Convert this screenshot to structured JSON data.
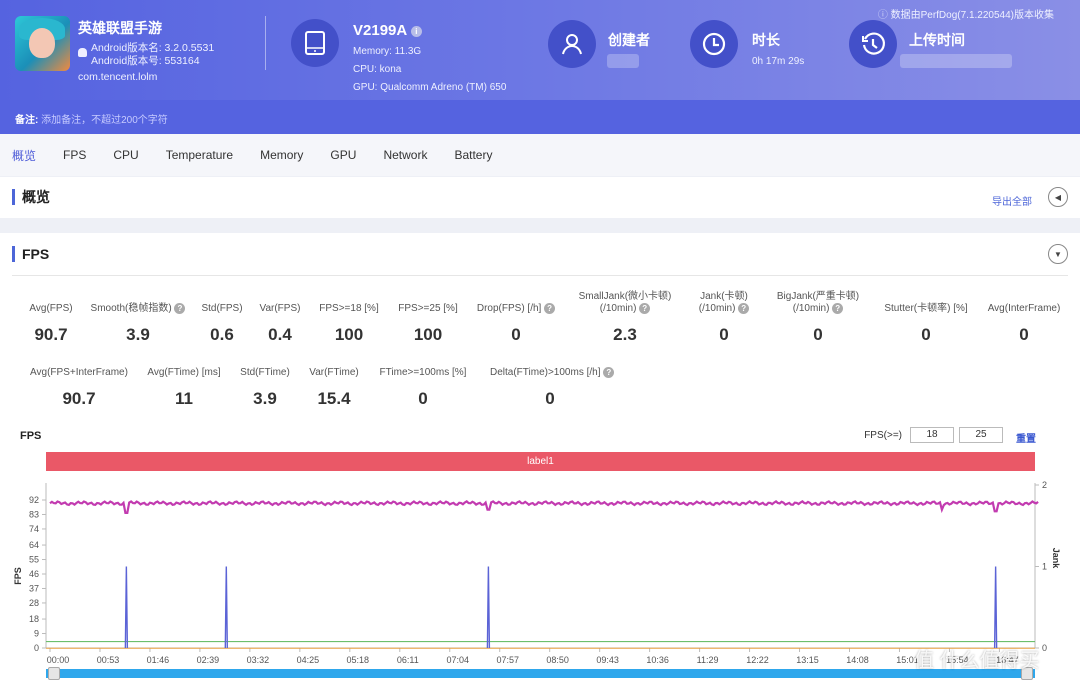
{
  "app": {
    "title": "英雄联盟手游",
    "version_name": "Android版本名: 3.2.0.5531",
    "version_code": "Android版本号: 553164",
    "package": "com.tencent.lolm"
  },
  "device": {
    "model": "V2199A",
    "memory": "Memory: 11.3G",
    "cpu": "CPU: kona",
    "gpu": "GPU: Qualcomm Adreno (TM) 650"
  },
  "creator": {
    "title": "创建者"
  },
  "duration": {
    "title": "时长",
    "value": "0h 17m 29s"
  },
  "upload": {
    "title": "上传时间"
  },
  "collect_note": "数据由PerfDog(7.1.220544)版本收集",
  "note": {
    "label": "备注:",
    "placeholder": "添加备注，不超过200个字符"
  },
  "tabs": [
    "概览",
    "FPS",
    "CPU",
    "Temperature",
    "Memory",
    "GPU",
    "Network",
    "Battery"
  ],
  "overview": {
    "title": "概览",
    "export_label": "导出全部"
  },
  "fps_section": {
    "title": "FPS",
    "metrics_row1": [
      {
        "label": "Avg(FPS)",
        "value": "90.7"
      },
      {
        "label": "Smooth(稳帧指数)",
        "value": "3.9",
        "help": true
      },
      {
        "label": "Std(FPS)",
        "value": "0.6"
      },
      {
        "label": "Var(FPS)",
        "value": "0.4"
      },
      {
        "label": "FPS>=18 [%]",
        "value": "100"
      },
      {
        "label": "FPS>=25 [%]",
        "value": "100"
      },
      {
        "label": "Drop(FPS) [/h]",
        "value": "0",
        "help": true
      },
      {
        "label": "SmallJank(微小卡顿)",
        "label2": "(/10min)",
        "value": "2.3",
        "help": true
      },
      {
        "label": "Jank(卡顿)",
        "label2": "(/10min)",
        "value": "0",
        "help": true
      },
      {
        "label": "BigJank(严重卡顿)",
        "label2": "(/10min)",
        "value": "0",
        "help": true
      },
      {
        "label": "Stutter(卡顿率) [%]",
        "value": "0"
      },
      {
        "label": "Avg(InterFrame)",
        "value": "0"
      }
    ],
    "metrics_row2": [
      {
        "label": "Avg(FPS+InterFrame)",
        "value": "90.7"
      },
      {
        "label": "Avg(FTime) [ms]",
        "value": "11"
      },
      {
        "label": "Std(FTime)",
        "value": "3.9"
      },
      {
        "label": "Var(FTime)",
        "value": "15.4"
      },
      {
        "label": "FTime>=100ms [%]",
        "value": "0"
      },
      {
        "label": "Delta(FTime)>100ms [/h]",
        "value": "0",
        "help": true
      }
    ],
    "chart_title": "FPS",
    "filter_label": "FPS(>=)",
    "filter_values": [
      "18",
      "25"
    ],
    "reset_label": "重置",
    "band_label": "label1"
  },
  "chart_data": {
    "type": "line",
    "title": "FPS",
    "ylabel": "FPS",
    "y2label": "Jank",
    "ylim": [
      0,
      92
    ],
    "y2lim": [
      0,
      2
    ],
    "yticks": [
      0,
      9,
      18,
      28,
      37,
      46,
      55,
      64,
      74,
      83,
      92
    ],
    "y2ticks": [
      0,
      1,
      2
    ],
    "xticks": [
      "00:00",
      "00:53",
      "01:46",
      "02:39",
      "03:32",
      "04:25",
      "05:18",
      "06:11",
      "07:04",
      "07:57",
      "08:50",
      "09:43",
      "10:36",
      "11:29",
      "12:22",
      "13:15",
      "14:08",
      "15:01",
      "15:54",
      "16:47"
    ],
    "x_range_seconds": [
      0,
      1049
    ],
    "series": [
      {
        "name": "FPS",
        "color": "#c23bb0",
        "baseline": 90,
        "dips": [
          {
            "t": 81,
            "v": 84
          },
          {
            "t": 465,
            "v": 86
          },
          {
            "t": 946,
            "v": 86
          },
          {
            "t": 1003,
            "v": 85
          }
        ]
      },
      {
        "name": "SmallJank",
        "color": "#5b63d6",
        "axis": "right",
        "spikes": [
          {
            "t": 81,
            "v": 1
          },
          {
            "t": 187,
            "v": 1
          },
          {
            "t": 465,
            "v": 1
          },
          {
            "t": 1003,
            "v": 1
          }
        ]
      },
      {
        "name": "InterFrame",
        "color": "#6cbf6c",
        "baseline": 4
      },
      {
        "name": "Jank",
        "color": "#e8a040",
        "baseline": 0.5
      }
    ]
  },
  "watermark": "值 什么值得买"
}
